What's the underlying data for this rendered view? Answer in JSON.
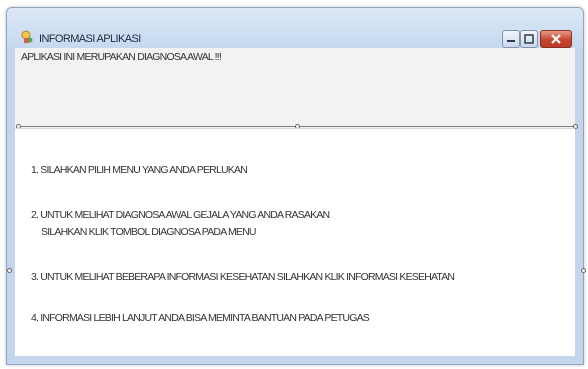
{
  "window": {
    "title": "INFORMASI APLIKASI"
  },
  "header": {
    "text": "APLIKASI INI MERUPAKAN DIAGNOSA AWAL !!!"
  },
  "instructions": [
    "1. SILAHKAN PILIH MENU YANG ANDA PERLUKAN",
    "2. UNTUK MELIHAT DIAGNOSA AWAL GEJALA YANG ANDA RASAKAN",
    "SILAHKAN KLIK TOMBOL DIAGNOSA PADA MENU",
    "3. UNTUK MELIHAT BEBERAPA INFORMASI KESEHATAN SILAHKAN KLIK INFORMASI KESEHATAN",
    "4. INFORMASI LEBIH LANJUT ANDA BISA MEMINTA BANTUAN PADA PETUGAS"
  ],
  "icons": {
    "app": "app-icon",
    "minimize": "minimize-icon",
    "maximize": "maximize-icon",
    "close": "close-icon"
  },
  "colors": {
    "titlebar": "#c6d9ef",
    "close_button": "#c8452e"
  }
}
